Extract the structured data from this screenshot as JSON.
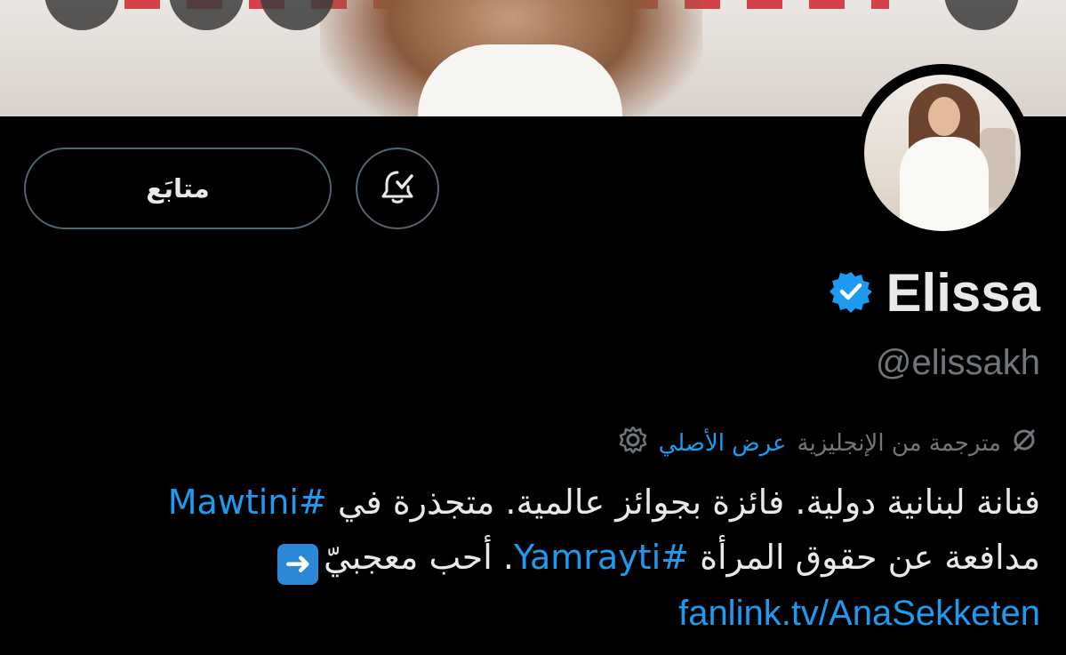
{
  "header": {
    "banner_description_icon": "banner-image"
  },
  "profile": {
    "display_name": "Elissa",
    "verified_icon": "verified-badge-icon",
    "handle": "@elissakh",
    "follow_button_label": "متابَع",
    "notifications_icon": "bell-check-icon"
  },
  "translation": {
    "icon": "translate-icon",
    "status": "مترجمة من الإنجليزية",
    "show_original": "عرض الأصلي",
    "settings_icon": "gear-icon"
  },
  "bio": {
    "line1_text": "فنانة لبنانية دولية. فائزة بجوائز عالمية. متجذرة في ",
    "line1_tag": "#Mawtini",
    "line2_text_a": "مدافعة عن حقوق المرأة ",
    "line2_tag": "#Yamrayti",
    "line2_text_b": ". أحب معجبيّ",
    "arrow_emoji": "➡️",
    "link": "fanlink.tv/AnaSekketen"
  },
  "colors": {
    "background": "#000000",
    "accent": "#1d9bf0",
    "muted": "#71767b",
    "text": "#e7e9ea"
  }
}
